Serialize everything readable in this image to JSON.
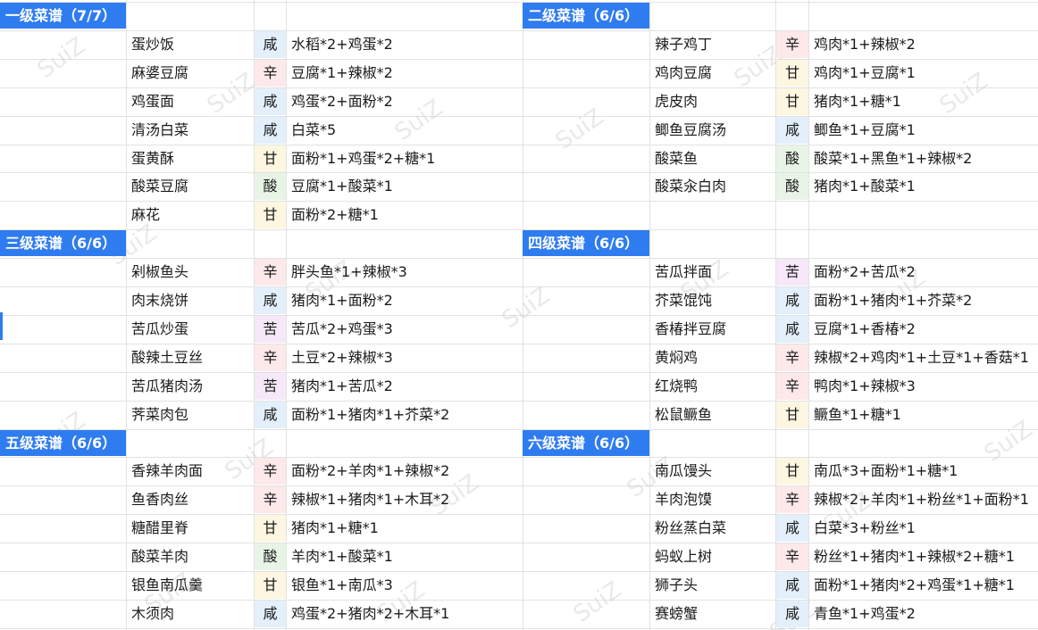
{
  "watermark": "SuiZ",
  "colors": {
    "header_bg": "#2f7cf0",
    "salty": "#e3f0fb",
    "spicy": "#fde8ea",
    "sweet": "#fdf6e0",
    "sour": "#e8f5e6",
    "bitter": "#f6e8f8"
  },
  "sections": [
    {
      "title": "一级菜谱（7/7）",
      "rows": [
        {
          "name": "蛋炒饭",
          "flavor": "咸",
          "ingredients": "水稻*2+鸡蛋*2"
        },
        {
          "name": "麻婆豆腐",
          "flavor": "辛",
          "ingredients": "豆腐*1+辣椒*2"
        },
        {
          "name": "鸡蛋面",
          "flavor": "咸",
          "ingredients": "鸡蛋*2+面粉*2"
        },
        {
          "name": "清汤白菜",
          "flavor": "咸",
          "ingredients": "白菜*5"
        },
        {
          "name": "蛋黄酥",
          "flavor": "甘",
          "ingredients": "面粉*1+鸡蛋*2+糖*1"
        },
        {
          "name": "酸菜豆腐",
          "flavor": "酸",
          "ingredients": "豆腐*1+酸菜*1"
        },
        {
          "name": "麻花",
          "flavor": "甘",
          "ingredients": "面粉*2+糖*1"
        }
      ]
    },
    {
      "title": "二级菜谱（6/6）",
      "rows": [
        {
          "name": "辣子鸡丁",
          "flavor": "辛",
          "ingredients": "鸡肉*1+辣椒*2"
        },
        {
          "name": "鸡肉豆腐",
          "flavor": "甘",
          "ingredients": "鸡肉*1+豆腐*1"
        },
        {
          "name": "虎皮肉",
          "flavor": "甘",
          "ingredients": "猪肉*1+糖*1"
        },
        {
          "name": "鲫鱼豆腐汤",
          "flavor": "咸",
          "ingredients": "鲫鱼*1+豆腐*1"
        },
        {
          "name": "酸菜鱼",
          "flavor": "酸",
          "ingredients": "酸菜*1+黑鱼*1+辣椒*2"
        },
        {
          "name": "酸菜汆白肉",
          "flavor": "酸",
          "ingredients": "猪肉*1+酸菜*1"
        }
      ]
    },
    {
      "title": "三级菜谱（6/6）",
      "rows": [
        {
          "name": "剁椒鱼头",
          "flavor": "辛",
          "ingredients": "胖头鱼*1+辣椒*3"
        },
        {
          "name": "肉末烧饼",
          "flavor": "咸",
          "ingredients": "猪肉*1+面粉*2"
        },
        {
          "name": "苦瓜炒蛋",
          "flavor": "苦",
          "ingredients": "苦瓜*2+鸡蛋*3"
        },
        {
          "name": "酸辣土豆丝",
          "flavor": "辛",
          "ingredients": "土豆*2+辣椒*3"
        },
        {
          "name": "苦瓜猪肉汤",
          "flavor": "苦",
          "ingredients": "猪肉*1+苦瓜*2"
        },
        {
          "name": "荠菜肉包",
          "flavor": "咸",
          "ingredients": "面粉*1+猪肉*1+芥菜*2"
        }
      ]
    },
    {
      "title": "四级菜谱（6/6）",
      "rows": [
        {
          "name": "苦瓜拌面",
          "flavor": "苦",
          "ingredients": "面粉*2+苦瓜*2"
        },
        {
          "name": "芥菜馄饨",
          "flavor": "咸",
          "ingredients": "面粉*1+猪肉*1+芥菜*2"
        },
        {
          "name": "香椿拌豆腐",
          "flavor": "咸",
          "ingredients": "豆腐*1+香椿*2"
        },
        {
          "name": "黄焖鸡",
          "flavor": "辛",
          "ingredients": "辣椒*2+鸡肉*1+土豆*1+香菇*1"
        },
        {
          "name": "红烧鸭",
          "flavor": "辛",
          "ingredients": "鸭肉*1+辣椒*3"
        },
        {
          "name": "松鼠鳜鱼",
          "flavor": "甘",
          "ingredients": "鳜鱼*1+糖*1"
        }
      ]
    },
    {
      "title": "五级菜谱（6/6）",
      "rows": [
        {
          "name": "香辣羊肉面",
          "flavor": "辛",
          "ingredients": "面粉*2+羊肉*1+辣椒*2"
        },
        {
          "name": "鱼香肉丝",
          "flavor": "辛",
          "ingredients": "辣椒*1+猪肉*1+木耳*2"
        },
        {
          "name": "糖醋里脊",
          "flavor": "甘",
          "ingredients": "猪肉*1+糖*1"
        },
        {
          "name": "酸菜羊肉",
          "flavor": "酸",
          "ingredients": "羊肉*1+酸菜*1"
        },
        {
          "name": "银鱼南瓜羹",
          "flavor": "甘",
          "ingredients": "银鱼*1+南瓜*3"
        },
        {
          "name": "木须肉",
          "flavor": "咸",
          "ingredients": "鸡蛋*2+猪肉*2+木耳*1"
        }
      ]
    },
    {
      "title": "六级菜谱（6/6）",
      "rows": [
        {
          "name": "南瓜馒头",
          "flavor": "甘",
          "ingredients": "南瓜*3+面粉*1+糖*1"
        },
        {
          "name": "羊肉泡馍",
          "flavor": "辛",
          "ingredients": "辣椒*2+羊肉*1+粉丝*1+面粉*1"
        },
        {
          "name": "粉丝蒸白菜",
          "flavor": "咸",
          "ingredients": "白菜*3+粉丝*1"
        },
        {
          "name": "蚂蚁上树",
          "flavor": "辛",
          "ingredients": "粉丝*1+猪肉*1+辣椒*2+糖*1"
        },
        {
          "name": "狮子头",
          "flavor": "咸",
          "ingredients": "面粉*1+猪肉*2+鸡蛋*1+糖*1"
        },
        {
          "name": "赛螃蟹",
          "flavor": "咸",
          "ingredients": "青鱼*1+鸡蛋*2"
        }
      ]
    }
  ]
}
